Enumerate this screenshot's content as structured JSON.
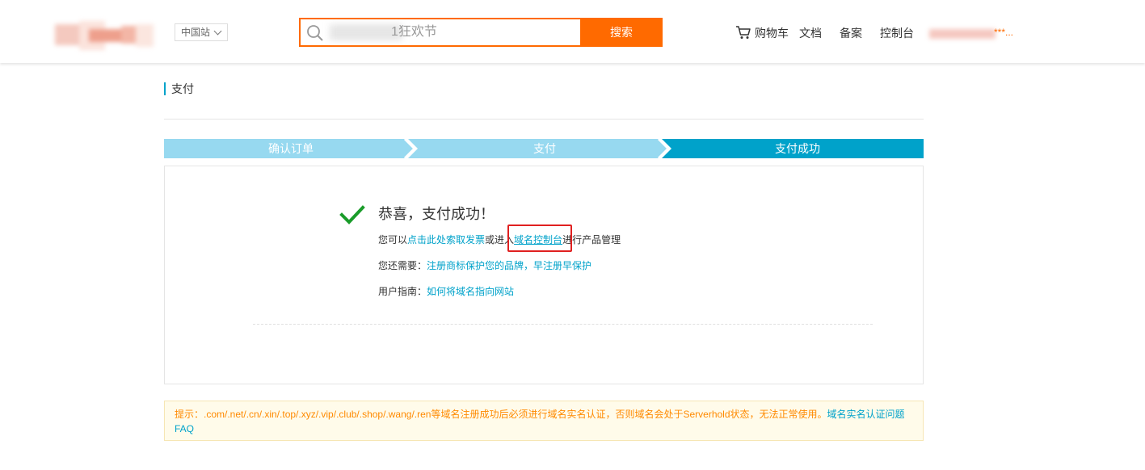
{
  "header": {
    "site_switch": "中国站",
    "search_placeholder": "1狂欢节",
    "search_button": "搜索",
    "nav": {
      "cart": "购物车",
      "docs": "文档",
      "beian": "备案",
      "console": "控制台"
    },
    "user_name": "***..."
  },
  "breadcrumb": {
    "title": "支付"
  },
  "steps": [
    {
      "label": "确认订单",
      "state": "done"
    },
    {
      "label": "支付",
      "state": "done"
    },
    {
      "label": "支付成功",
      "state": "current"
    }
  ],
  "success": {
    "title": "恭喜，支付成功！",
    "line1_prefix": "您可以",
    "line1_link1": "点击此处索取发票",
    "line1_mid": "或进入",
    "line1_link2": "域名控制台",
    "line1_suffix": "进行产品管理",
    "line2_prefix": "您还需要：",
    "line2_link": "注册商标保护您的品牌，早注册早保护",
    "line3_prefix": "用户指南：",
    "line3_link": "如何将域名指向网站"
  },
  "tip": {
    "text": "提示：.com/.net/.cn/.xin/.top/.xyz/.vip/.club/.shop/.wang/.ren等域名注册成功后必须进行域名实名认证，否则域名会处于Serverhold状态，无法正常使用。",
    "link": "域名实名认证问题FAQ"
  },
  "colors": {
    "brand_orange": "#ff6a00",
    "step_done": "#97d9f0",
    "step_current": "#00a2ca",
    "link": "#00a2ca",
    "success_check": "#1a9c2a",
    "highlight_box": "#e02020"
  },
  "icons": [
    "search-icon",
    "cart-icon",
    "chevron-down-icon",
    "checkmark-icon"
  ]
}
